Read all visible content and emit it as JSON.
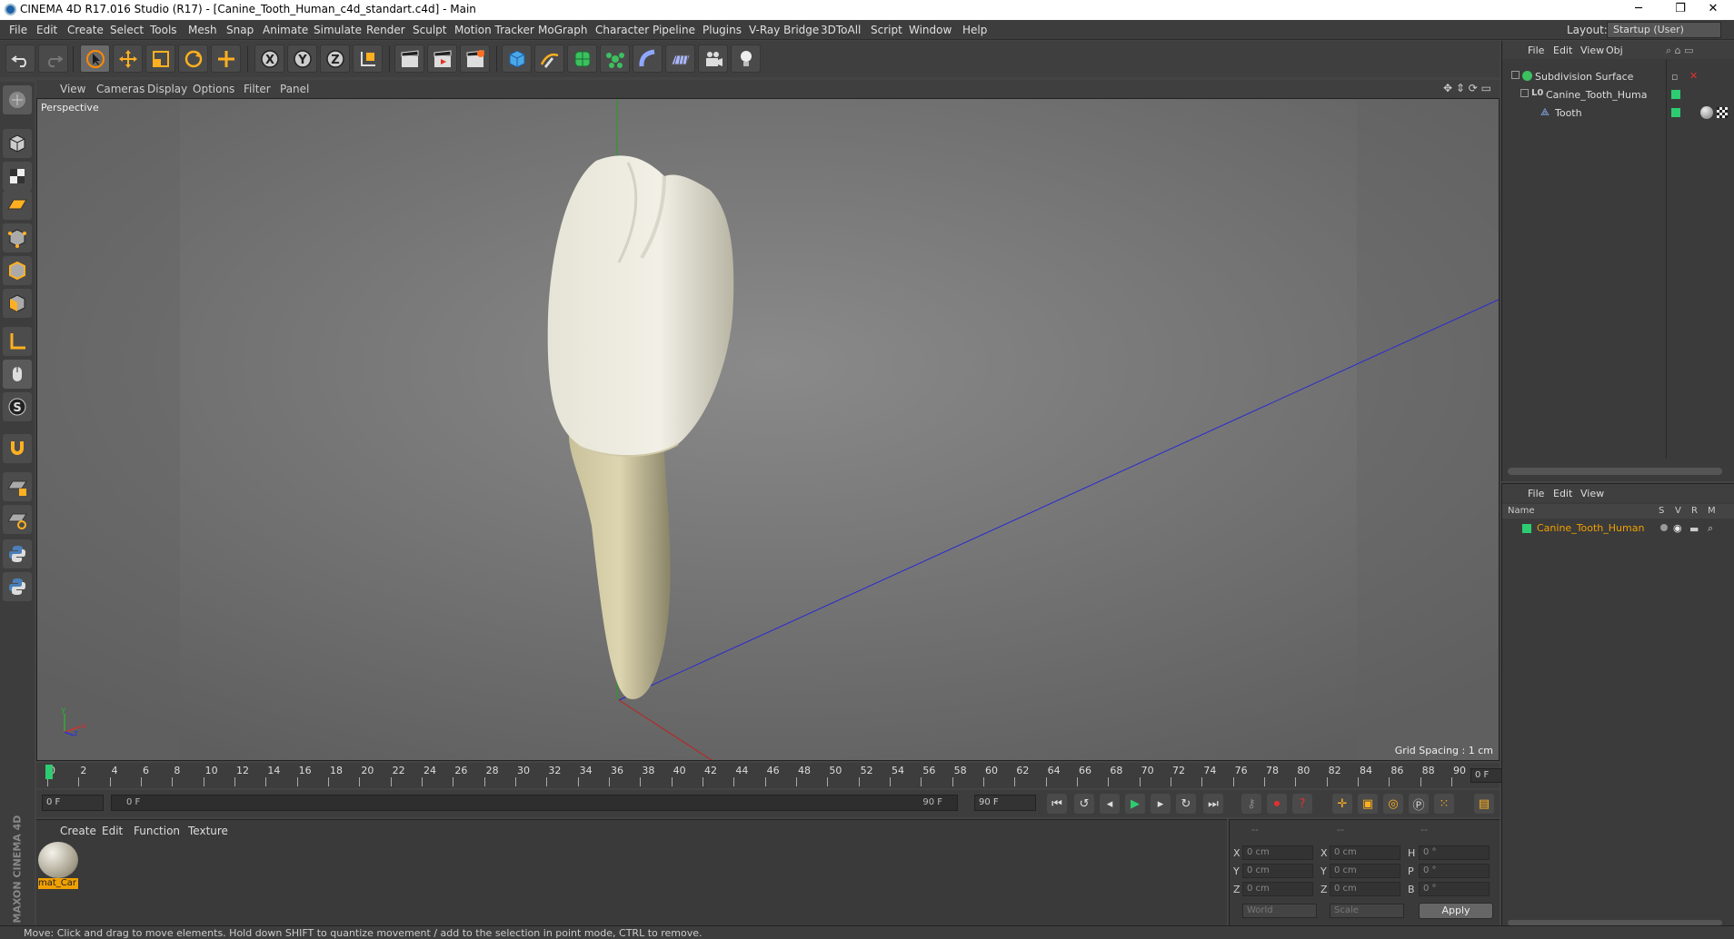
{
  "window": {
    "title": "CINEMA 4D R17.016 Studio (R17) - [Canine_Tooth_Human_c4d_standart.c4d] - Main",
    "minimize": "─",
    "restore": "❐",
    "close": "✕"
  },
  "menubar": {
    "items": [
      "File",
      "Edit",
      "Create",
      "Select",
      "Tools",
      "Mesh",
      "Snap",
      "Animate",
      "Simulate",
      "Render",
      "Sculpt",
      "Motion Tracker",
      "MoGraph",
      "Character",
      "Pipeline",
      "Plugins",
      "V-Ray Bridge",
      "3DToAll",
      "Script",
      "Window",
      "Help"
    ],
    "layout_label": "Layout:",
    "layout_value": "Startup (User)"
  },
  "viewport": {
    "menu": [
      "View",
      "Cameras",
      "Display",
      "Options",
      "Filter",
      "Panel"
    ],
    "label": "Perspective",
    "grid_spacing": "Grid Spacing : 1 cm",
    "axis_y": "y",
    "axis_x": "x",
    "axis_z": "z"
  },
  "timeline": {
    "ticks": [
      "0",
      "2",
      "4",
      "6",
      "8",
      "10",
      "12",
      "14",
      "16",
      "18",
      "20",
      "22",
      "24",
      "26",
      "28",
      "30",
      "32",
      "34",
      "36",
      "38",
      "40",
      "42",
      "44",
      "46",
      "48",
      "50",
      "52",
      "54",
      "56",
      "58",
      "60",
      "62",
      "64",
      "66",
      "68",
      "70",
      "72",
      "74",
      "76",
      "78",
      "80",
      "82",
      "84",
      "86",
      "88",
      "90"
    ],
    "current_frame": "0 F"
  },
  "playbar": {
    "start_field": "0 F",
    "range_start": "0 F",
    "range_end": "90 F",
    "end_field": "90 F"
  },
  "material_panel": {
    "menu": [
      "Create",
      "Edit",
      "Function",
      "Texture"
    ],
    "material_name": "mat_Car"
  },
  "coord_panel": {
    "col_headers": [
      "--",
      "--",
      "--"
    ],
    "rows": [
      {
        "l1": "X",
        "v1": "0 cm",
        "l2": "X",
        "v2": "0 cm",
        "l3": "H",
        "v3": "0 °"
      },
      {
        "l1": "Y",
        "v1": "0 cm",
        "l2": "Y",
        "v2": "0 cm",
        "l3": "P",
        "v3": "0 °"
      },
      {
        "l1": "Z",
        "v1": "0 cm",
        "l2": "Z",
        "v2": "0 cm",
        "l3": "B",
        "v3": "0 °"
      }
    ],
    "mode": "World",
    "transform": "Scale",
    "apply": "Apply"
  },
  "object_manager": {
    "menu": [
      "File",
      "Edit",
      "View",
      "Obj"
    ],
    "objects": [
      {
        "name": "Subdivision Surface",
        "depth": 0
      },
      {
        "name": "Canine_Tooth_Huma",
        "depth": 1
      },
      {
        "name": "Tooth",
        "depth": 2
      }
    ]
  },
  "layer_manager": {
    "menu": [
      "File",
      "Edit",
      "View"
    ],
    "col_name": "Name",
    "cols": [
      "S",
      "V",
      "R",
      "M"
    ],
    "layers": [
      {
        "name": "Canine_Tooth_Human",
        "color": "#2ecc71"
      }
    ]
  },
  "status": "Move: Click and drag to move elements. Hold down SHIFT to quantize movement / add to the selection in point mode, CTRL to remove.",
  "branding": "MAXON CINEMA 4D",
  "colors": {
    "accent": "#f0a000",
    "layer_green": "#2ecc71",
    "axis_blue": "#2a2ad0",
    "axis_red": "#c02020",
    "axis_green": "#20a020"
  }
}
